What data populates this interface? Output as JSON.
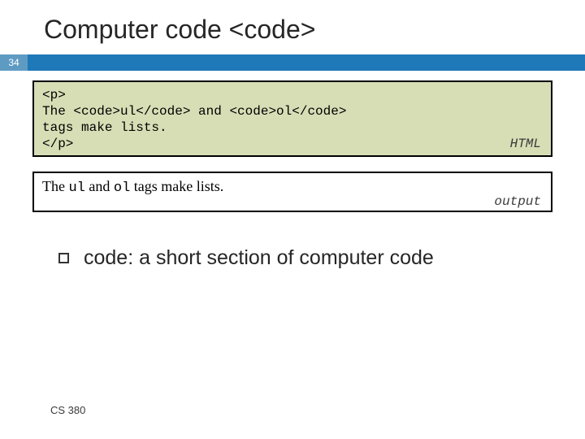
{
  "title": "Computer code <code>",
  "slideNumber": "34",
  "codeBlock": {
    "line1": "<p>",
    "line2": "The <code>ul</code> and <code>ol</code>",
    "line3": "tags make lists.",
    "line4": "</p>",
    "label": "HTML"
  },
  "outputBlock": {
    "prefix": "The ",
    "code1": "ul",
    "mid": " and ",
    "code2": "ol",
    "suffix": " tags make lists.",
    "label": "output"
  },
  "bullet1": "code: a short section of computer code",
  "footer": "CS 380"
}
